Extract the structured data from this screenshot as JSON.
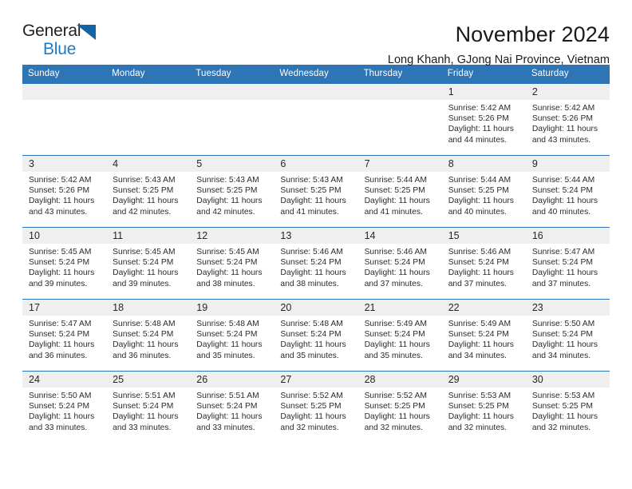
{
  "brand": {
    "line1": "General",
    "line2": "Blue",
    "triangle_icon": "triangle-icon",
    "color_dark": "#231f20",
    "color_blue": "#1f7bc1"
  },
  "header": {
    "title": "November 2024",
    "subtitle": "Long Khanh, GJong Nai Province, Vietnam"
  },
  "theme": {
    "header_blue": "#2e75b6",
    "daynum_gray": "#efefef",
    "text": "#1a1a1a"
  },
  "calendar": {
    "weekdays": [
      "Sunday",
      "Monday",
      "Tuesday",
      "Wednesday",
      "Thursday",
      "Friday",
      "Saturday"
    ],
    "labels": {
      "sunrise": "Sunrise:",
      "sunset": "Sunset:",
      "daylight": "Daylight:"
    },
    "weeks": [
      [
        {
          "day": "",
          "empty": true
        },
        {
          "day": "",
          "empty": true
        },
        {
          "day": "",
          "empty": true
        },
        {
          "day": "",
          "empty": true
        },
        {
          "day": "",
          "empty": true
        },
        {
          "day": "1",
          "sunrise": "Sunrise: 5:42 AM",
          "sunset": "Sunset: 5:26 PM",
          "daylight_1": "Daylight: 11 hours",
          "daylight_2": "and 44 minutes."
        },
        {
          "day": "2",
          "sunrise": "Sunrise: 5:42 AM",
          "sunset": "Sunset: 5:26 PM",
          "daylight_1": "Daylight: 11 hours",
          "daylight_2": "and 43 minutes."
        }
      ],
      [
        {
          "day": "3",
          "sunrise": "Sunrise: 5:42 AM",
          "sunset": "Sunset: 5:26 PM",
          "daylight_1": "Daylight: 11 hours",
          "daylight_2": "and 43 minutes."
        },
        {
          "day": "4",
          "sunrise": "Sunrise: 5:43 AM",
          "sunset": "Sunset: 5:25 PM",
          "daylight_1": "Daylight: 11 hours",
          "daylight_2": "and 42 minutes."
        },
        {
          "day": "5",
          "sunrise": "Sunrise: 5:43 AM",
          "sunset": "Sunset: 5:25 PM",
          "daylight_1": "Daylight: 11 hours",
          "daylight_2": "and 42 minutes."
        },
        {
          "day": "6",
          "sunrise": "Sunrise: 5:43 AM",
          "sunset": "Sunset: 5:25 PM",
          "daylight_1": "Daylight: 11 hours",
          "daylight_2": "and 41 minutes."
        },
        {
          "day": "7",
          "sunrise": "Sunrise: 5:44 AM",
          "sunset": "Sunset: 5:25 PM",
          "daylight_1": "Daylight: 11 hours",
          "daylight_2": "and 41 minutes."
        },
        {
          "day": "8",
          "sunrise": "Sunrise: 5:44 AM",
          "sunset": "Sunset: 5:25 PM",
          "daylight_1": "Daylight: 11 hours",
          "daylight_2": "and 40 minutes."
        },
        {
          "day": "9",
          "sunrise": "Sunrise: 5:44 AM",
          "sunset": "Sunset: 5:24 PM",
          "daylight_1": "Daylight: 11 hours",
          "daylight_2": "and 40 minutes."
        }
      ],
      [
        {
          "day": "10",
          "sunrise": "Sunrise: 5:45 AM",
          "sunset": "Sunset: 5:24 PM",
          "daylight_1": "Daylight: 11 hours",
          "daylight_2": "and 39 minutes."
        },
        {
          "day": "11",
          "sunrise": "Sunrise: 5:45 AM",
          "sunset": "Sunset: 5:24 PM",
          "daylight_1": "Daylight: 11 hours",
          "daylight_2": "and 39 minutes."
        },
        {
          "day": "12",
          "sunrise": "Sunrise: 5:45 AM",
          "sunset": "Sunset: 5:24 PM",
          "daylight_1": "Daylight: 11 hours",
          "daylight_2": "and 38 minutes."
        },
        {
          "day": "13",
          "sunrise": "Sunrise: 5:46 AM",
          "sunset": "Sunset: 5:24 PM",
          "daylight_1": "Daylight: 11 hours",
          "daylight_2": "and 38 minutes."
        },
        {
          "day": "14",
          "sunrise": "Sunrise: 5:46 AM",
          "sunset": "Sunset: 5:24 PM",
          "daylight_1": "Daylight: 11 hours",
          "daylight_2": "and 37 minutes."
        },
        {
          "day": "15",
          "sunrise": "Sunrise: 5:46 AM",
          "sunset": "Sunset: 5:24 PM",
          "daylight_1": "Daylight: 11 hours",
          "daylight_2": "and 37 minutes."
        },
        {
          "day": "16",
          "sunrise": "Sunrise: 5:47 AM",
          "sunset": "Sunset: 5:24 PM",
          "daylight_1": "Daylight: 11 hours",
          "daylight_2": "and 37 minutes."
        }
      ],
      [
        {
          "day": "17",
          "sunrise": "Sunrise: 5:47 AM",
          "sunset": "Sunset: 5:24 PM",
          "daylight_1": "Daylight: 11 hours",
          "daylight_2": "and 36 minutes."
        },
        {
          "day": "18",
          "sunrise": "Sunrise: 5:48 AM",
          "sunset": "Sunset: 5:24 PM",
          "daylight_1": "Daylight: 11 hours",
          "daylight_2": "and 36 minutes."
        },
        {
          "day": "19",
          "sunrise": "Sunrise: 5:48 AM",
          "sunset": "Sunset: 5:24 PM",
          "daylight_1": "Daylight: 11 hours",
          "daylight_2": "and 35 minutes."
        },
        {
          "day": "20",
          "sunrise": "Sunrise: 5:48 AM",
          "sunset": "Sunset: 5:24 PM",
          "daylight_1": "Daylight: 11 hours",
          "daylight_2": "and 35 minutes."
        },
        {
          "day": "21",
          "sunrise": "Sunrise: 5:49 AM",
          "sunset": "Sunset: 5:24 PM",
          "daylight_1": "Daylight: 11 hours",
          "daylight_2": "and 35 minutes."
        },
        {
          "day": "22",
          "sunrise": "Sunrise: 5:49 AM",
          "sunset": "Sunset: 5:24 PM",
          "daylight_1": "Daylight: 11 hours",
          "daylight_2": "and 34 minutes."
        },
        {
          "day": "23",
          "sunrise": "Sunrise: 5:50 AM",
          "sunset": "Sunset: 5:24 PM",
          "daylight_1": "Daylight: 11 hours",
          "daylight_2": "and 34 minutes."
        }
      ],
      [
        {
          "day": "24",
          "sunrise": "Sunrise: 5:50 AM",
          "sunset": "Sunset: 5:24 PM",
          "daylight_1": "Daylight: 11 hours",
          "daylight_2": "and 33 minutes."
        },
        {
          "day": "25",
          "sunrise": "Sunrise: 5:51 AM",
          "sunset": "Sunset: 5:24 PM",
          "daylight_1": "Daylight: 11 hours",
          "daylight_2": "and 33 minutes."
        },
        {
          "day": "26",
          "sunrise": "Sunrise: 5:51 AM",
          "sunset": "Sunset: 5:24 PM",
          "daylight_1": "Daylight: 11 hours",
          "daylight_2": "and 33 minutes."
        },
        {
          "day": "27",
          "sunrise": "Sunrise: 5:52 AM",
          "sunset": "Sunset: 5:25 PM",
          "daylight_1": "Daylight: 11 hours",
          "daylight_2": "and 32 minutes."
        },
        {
          "day": "28",
          "sunrise": "Sunrise: 5:52 AM",
          "sunset": "Sunset: 5:25 PM",
          "daylight_1": "Daylight: 11 hours",
          "daylight_2": "and 32 minutes."
        },
        {
          "day": "29",
          "sunrise": "Sunrise: 5:53 AM",
          "sunset": "Sunset: 5:25 PM",
          "daylight_1": "Daylight: 11 hours",
          "daylight_2": "and 32 minutes."
        },
        {
          "day": "30",
          "sunrise": "Sunrise: 5:53 AM",
          "sunset": "Sunset: 5:25 PM",
          "daylight_1": "Daylight: 11 hours",
          "daylight_2": "and 32 minutes."
        }
      ]
    ]
  }
}
